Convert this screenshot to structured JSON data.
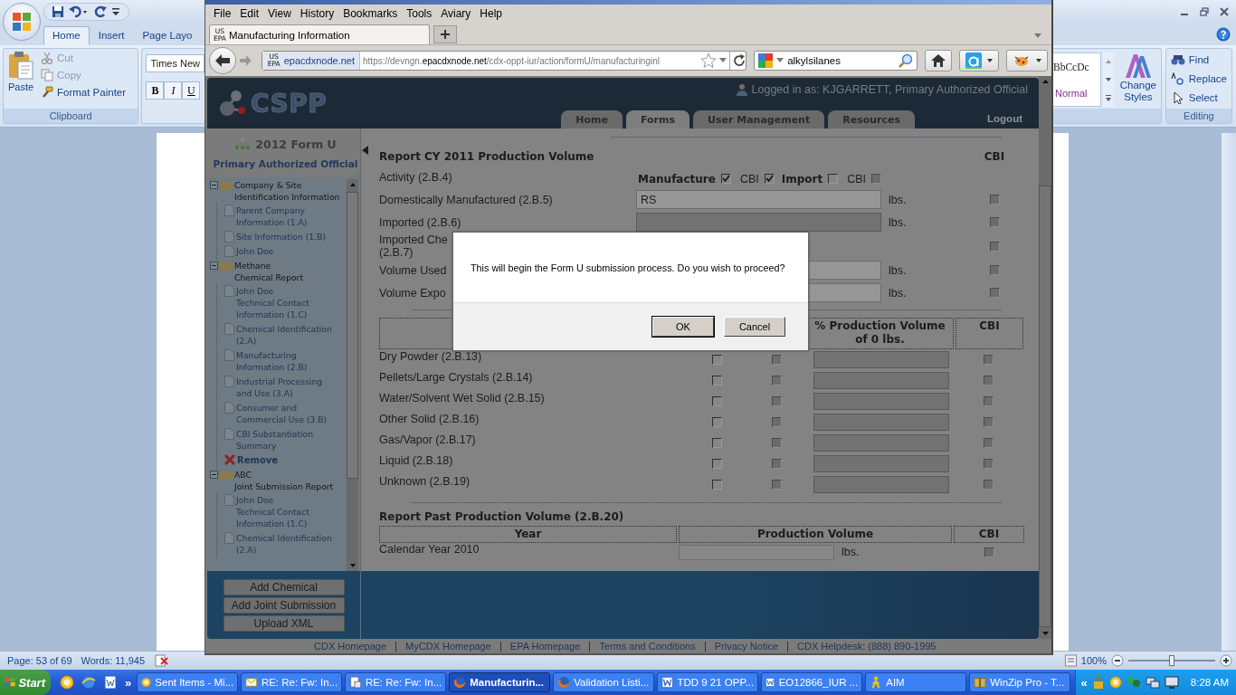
{
  "word": {
    "tabs": [
      {
        "label": "Home",
        "selected": true
      },
      {
        "label": "Insert",
        "selected": false
      },
      {
        "label": "Page Layo",
        "selected": false
      }
    ],
    "clipboard": {
      "paste": "Paste",
      "cut": "Cut",
      "copy": "Copy",
      "format_painter": "Format Painter",
      "group_label": "Clipboard"
    },
    "font": {
      "name": "Times New",
      "bold": "B",
      "italic": "I",
      "underline": "U"
    },
    "styles": {
      "sample": "BbCcDc",
      "style_name": "Normal",
      "change_styles": "Change Styles"
    },
    "editing": {
      "find": "Find",
      "replace": "Replace",
      "select": "Select",
      "group_label": "Editing"
    },
    "status_bar": {
      "page": "Page: 53 of 69",
      "words": "Words: 11,945",
      "zoom": "100%",
      "zoom_slider": {
        "level": 0.5
      }
    }
  },
  "browser": {
    "menu": [
      "File",
      "Edit",
      "View",
      "History",
      "Bookmarks",
      "Tools",
      "Aviary",
      "Help"
    ],
    "tab": {
      "favicon": "US EPA",
      "title": "Manufacturing Information"
    },
    "identity": {
      "favicon": "US EPA",
      "domain": "epacdxnode.net"
    },
    "url": "https://devngn.**epacdxnode.net**/cdx-oppt-iur/action/formU/manufacturinginl",
    "search": "alkylsilanes"
  },
  "page": {
    "logo": "CSPP",
    "logged_in": "Logged in as: KJGARRETT, Primary Authorized Official",
    "nav": [
      {
        "label": "Home",
        "selected": false
      },
      {
        "label": "Forms",
        "selected": true
      },
      {
        "label": "User Management",
        "selected": false
      },
      {
        "label": "Resources",
        "selected": false
      }
    ],
    "logout": "Logout",
    "sidebar": {
      "title": "2012 Form U",
      "role": "Primary Authorized Official",
      "tree": [
        {
          "label": "Company & Site",
          "sublabel": "Identification Information",
          "expanded": true,
          "children": [
            {
              "kind": "link",
              "label": "Parent Company Information (1.A)"
            },
            {
              "kind": "link",
              "label": "Site Information (1.B)"
            },
            {
              "kind": "link",
              "label": "John Doe"
            }
          ]
        },
        {
          "label": "Methane",
          "sublabel": "Chemical Report",
          "expanded": true,
          "children": [
            {
              "kind": "link",
              "label": "John Doe",
              "sublabel": "Technical Contact Information (1.C)"
            },
            {
              "kind": "link",
              "label": "Chemical Identification (2.A)"
            },
            {
              "kind": "link",
              "label": "Manufacturing Information (2.B)"
            },
            {
              "kind": "link",
              "label": "Industrial Processing and Use (3.A)"
            },
            {
              "kind": "link",
              "label": "Consumer and Commercial Use (3.B)"
            },
            {
              "kind": "link",
              "label": "CBI Substantiation Summary"
            },
            {
              "kind": "remove",
              "label": "Remove"
            }
          ]
        },
        {
          "label": "ABC",
          "sublabel": "Joint Submission Report",
          "expanded": true,
          "children": [
            {
              "kind": "link",
              "label": "John Doe",
              "sublabel": "Technical Contact Information (1.C)"
            },
            {
              "kind": "link",
              "label": "Chemical Identification (2.A)"
            }
          ]
        }
      ],
      "buttons": [
        "Add Chemical",
        "Add Joint Submission",
        "Upload XML"
      ]
    },
    "production": {
      "title": "Report CY 2011 Production Volume",
      "cbi_header": "CBI",
      "activity_label": "Activity (2.B.4)",
      "activity": [
        {
          "label": "Manufacture",
          "kind": "bold",
          "checked": true,
          "disabled": false
        },
        {
          "label": "CBI",
          "kind": "plain",
          "checked": true,
          "disabled": false
        },
        {
          "label": "Import",
          "kind": "bold",
          "checked": false,
          "disabled": false
        },
        {
          "label": "CBI",
          "kind": "plain",
          "checked": false,
          "disabled": true
        }
      ],
      "rows": [
        {
          "kind": "field",
          "label": "Domestically Manufactured (2.B.5)",
          "value": "RS",
          "disabled": false,
          "unit": "lbs.",
          "cbi": {
            "checked": false,
            "disabled": true
          }
        },
        {
          "kind": "field",
          "label": "Imported (2.B.6)",
          "disabled": true,
          "unit": "lbs.",
          "cbi": {
            "checked": false,
            "disabled": true
          }
        },
        {
          "kind": "label_only",
          "label": "Imported Che",
          "sublabel": "(2.B.7)",
          "cbi": {
            "checked": false,
            "disabled": true
          }
        },
        {
          "kind": "field",
          "label": "Volume Used",
          "disabled": false,
          "unit": "lbs.",
          "cbi": {
            "checked": false,
            "disabled": true
          }
        },
        {
          "kind": "field",
          "label": "Volume Expo",
          "disabled": false,
          "unit": "lbs.",
          "cbi": {
            "checked": false,
            "disabled": true
          }
        }
      ]
    },
    "physical_form": {
      "headers": [
        "% Production Volume of 0 lbs.",
        "CBI"
      ],
      "rows": [
        {
          "label": "Dry Powder (2.B.13)",
          "col_1": {
            "checked": false,
            "disabled": false
          },
          "col_2": {
            "checked": false,
            "disabled": true
          },
          "cbi": {
            "checked": false,
            "disabled": true
          }
        },
        {
          "label": "Pellets/Large Crystals (2.B.14)",
          "col_1": {
            "checked": false,
            "disabled": false
          },
          "col_2": {
            "checked": false,
            "disabled": true
          },
          "cbi": {
            "checked": false,
            "disabled": true
          }
        },
        {
          "label": "Water/Solvent Wet Solid (2.B.15)",
          "col_1": {
            "checked": false,
            "disabled": false
          },
          "col_2": {
            "checked": false,
            "disabled": true
          },
          "cbi": {
            "checked": false,
            "disabled": true
          }
        },
        {
          "label": "Other Solid (2.B.16)",
          "col_1": {
            "checked": false,
            "disabled": false
          },
          "col_2": {
            "checked": false,
            "disabled": true
          },
          "cbi": {
            "checked": false,
            "disabled": true
          }
        },
        {
          "label": "Gas/Vapor (2.B.17)",
          "col_1": {
            "checked": false,
            "disabled": false
          },
          "col_2": {
            "checked": false,
            "disabled": true
          },
          "cbi": {
            "checked": false,
            "disabled": true
          }
        },
        {
          "label": "Liquid (2.B.18)",
          "col_1": {
            "checked": false,
            "disabled": false
          },
          "col_2": {
            "checked": false,
            "disabled": true
          },
          "cbi": {
            "checked": false,
            "disabled": true
          }
        },
        {
          "label": "Unknown (2.B.19)",
          "col_1": {
            "checked": false,
            "disabled": false
          },
          "col_2": {
            "checked": false,
            "disabled": true
          },
          "cbi": {
            "checked": false,
            "disabled": true
          }
        }
      ]
    },
    "past": {
      "title": "Report Past Production Volume (2.B.20)",
      "headers": [
        "Year",
        "Production Volume",
        "CBI"
      ],
      "rows": [
        {
          "year": "Calendar Year 2010",
          "unit": "lbs.",
          "cbi": {
            "checked": false,
            "disabled": true
          }
        }
      ]
    },
    "footer": [
      "CDX Homepage",
      "MyCDX Homepage",
      "EPA Homepage",
      "Terms and Conditions",
      "Privacy Notice",
      "CDX Helpdesk: (888) 890-1995"
    ]
  },
  "dialog": {
    "message": "This will begin the Form U submission process. Do you wish to proceed?",
    "buttons": [
      "OK",
      "Cancel"
    ]
  },
  "taskbar": {
    "start": "Start",
    "quick_launch_more": "»",
    "items": [
      {
        "label": "Sent Items - Mi...",
        "kind": "outlook",
        "selected": false
      },
      {
        "label": "RE: Re: Fw: In...",
        "kind": "mail",
        "selected": false
      },
      {
        "label": "RE: Re: Fw: In...",
        "kind": "document",
        "selected": false
      },
      {
        "label": "Manufacturin...",
        "kind": "firefox",
        "selected": true
      },
      {
        "label": "Validation Listi...",
        "kind": "firefox",
        "selected": false
      },
      {
        "label": "TDD 9 21 OPP...",
        "kind": "word",
        "selected": false
      },
      {
        "label": "EO12866_IUR ...",
        "kind": "word",
        "selected": false
      },
      {
        "label": "AIM",
        "kind": "aim",
        "selected": false
      },
      {
        "label": "WinZip Pro - T...",
        "kind": "winzip",
        "selected": false
      }
    ],
    "tray_more": "«",
    "clock": "8:28 AM"
  }
}
